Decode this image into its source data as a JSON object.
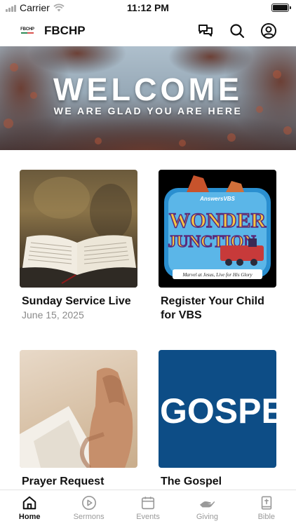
{
  "status_bar": {
    "carrier": "Carrier",
    "time": "11:12 PM"
  },
  "header": {
    "logo_text": "FBCHP",
    "title": "FBCHP"
  },
  "hero": {
    "title": "WELCOME",
    "subtitle": "WE ARE GLAD YOU ARE HERE"
  },
  "cards": [
    {
      "title": "Sunday Service Live",
      "subtitle": "June 15, 2025"
    },
    {
      "title": "Register Your Child for VBS",
      "subtitle": ""
    },
    {
      "title": "Prayer Request",
      "subtitle": ""
    },
    {
      "title": "The Gospel",
      "subtitle": ""
    }
  ],
  "vbs_art": {
    "brand": "AnswersVBS",
    "line1": "WONDER",
    "line2": "JUNCTION",
    "tagline": "Marvel at Jesus, Live for His Glory"
  },
  "gospel_art": {
    "text": "GOSPE"
  },
  "tabs": [
    {
      "label": "Home",
      "active": true
    },
    {
      "label": "Sermons",
      "active": false
    },
    {
      "label": "Events",
      "active": false
    },
    {
      "label": "Giving",
      "active": false
    },
    {
      "label": "Bible",
      "active": false
    }
  ],
  "colors": {
    "accent": "#111111",
    "inactive": "#9a9a9a",
    "gospel_bg": "#0d4d86"
  }
}
